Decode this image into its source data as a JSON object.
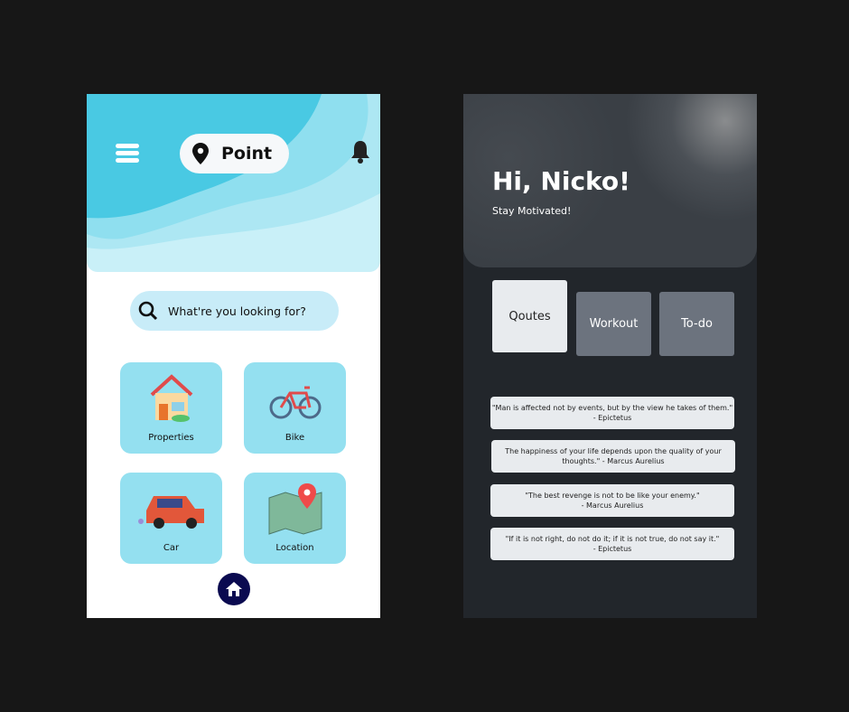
{
  "left": {
    "brand": "Point",
    "search": {
      "placeholder": "What're you looking for?"
    },
    "categories": [
      {
        "label": "Properties",
        "icon": "house-icon"
      },
      {
        "label": "Bike",
        "icon": "bike-icon"
      },
      {
        "label": "Car",
        "icon": "car-icon"
      },
      {
        "label": "Location",
        "icon": "map-icon"
      }
    ]
  },
  "right": {
    "greeting": "Hi, Nicko!",
    "subtitle": "Stay Motivated!",
    "tabs": [
      {
        "label": "Qoutes",
        "active": true
      },
      {
        "label": "Workout"
      },
      {
        "label": "To-do"
      }
    ],
    "quotes": [
      {
        "text": "\"Man is affected not by events, but by the view he takes of them.\"",
        "author": "- Epictetus"
      },
      {
        "text": "The happiness of your life depends upon the quality of your",
        "author": "thoughts.\" - Marcus Aurelius"
      },
      {
        "text": "\"The best revenge is not to be like your enemy.\"",
        "author": "- Marcus Aurelius"
      },
      {
        "text": "\"If it is not right, do not do it; if it is not true, do not say it.\"",
        "author": "- Epictetus"
      }
    ]
  },
  "colors": {
    "accent": "#4acbe3",
    "card": "#94e0f0",
    "dark": "#22262b"
  }
}
